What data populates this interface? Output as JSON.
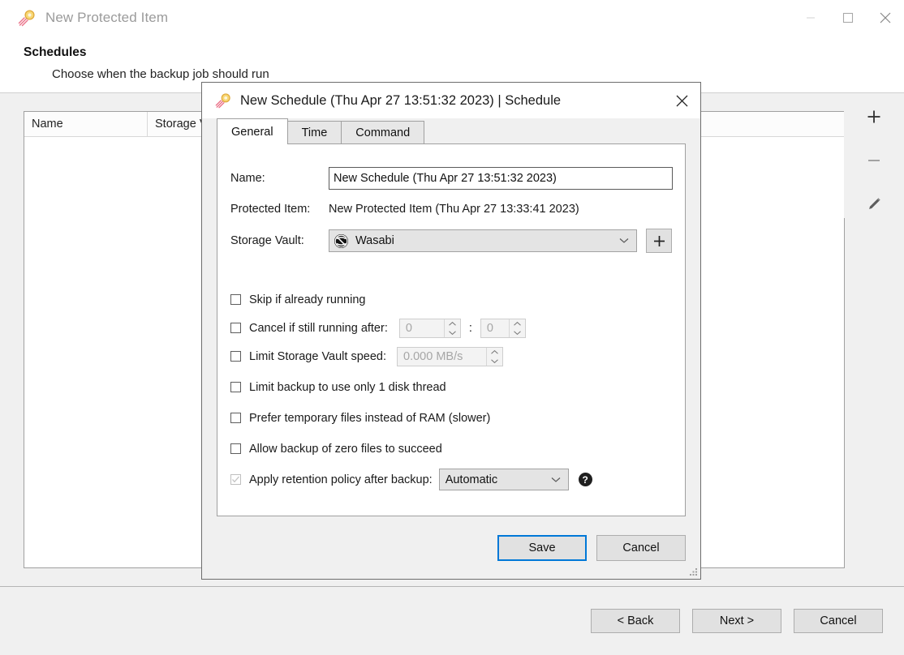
{
  "app_window": {
    "title": "New Protected Item",
    "icon": "comet-icon",
    "controls": {
      "minimize": "minimize-icon",
      "maximize": "maximize-icon",
      "close": "close-icon"
    },
    "header": {
      "title": "Schedules",
      "subtitle": "Choose when the backup job should run"
    },
    "table": {
      "columns": [
        "Name",
        "Storage V"
      ],
      "rows": []
    },
    "side_tools": [
      {
        "name": "add-schedule-button",
        "icon": "plus-icon"
      },
      {
        "name": "remove-schedule-button",
        "icon": "minus-icon"
      },
      {
        "name": "edit-schedule-button",
        "icon": "pencil-icon"
      }
    ],
    "footer_buttons": [
      {
        "name": "back-button",
        "label": "< Back"
      },
      {
        "name": "next-button",
        "label": "Next >"
      },
      {
        "name": "cancel-button",
        "label": "Cancel"
      }
    ]
  },
  "dialog": {
    "title": "New Schedule (Thu Apr 27 13:51:32 2023) | Schedule",
    "icon": "comet-icon",
    "close_label": "close-icon",
    "tabs": [
      {
        "label": "General",
        "active": true
      },
      {
        "label": "Time",
        "active": false
      },
      {
        "label": "Command",
        "active": false
      }
    ],
    "general": {
      "name_label": "Name:",
      "name_value": "New Schedule (Thu Apr 27 13:51:32 2023)",
      "protected_item_label": "Protected Item:",
      "protected_item_value": "New Protected Item (Thu Apr 27 13:33:41 2023)",
      "storage_vault_label": "Storage Vault:",
      "storage_vault_value": "Wasabi",
      "add_vault_label": "+",
      "options": [
        {
          "id": "skip-if-already-running",
          "label": "Skip if already running",
          "checked": false,
          "enabled": true
        },
        {
          "id": "cancel-if-still-running-after",
          "label": "Cancel if still running after:",
          "checked": false,
          "enabled": true,
          "hours_value": "0",
          "minutes_value": "0",
          "separator": ":"
        },
        {
          "id": "limit-storage-vault-speed",
          "label": "Limit Storage Vault speed:",
          "checked": false,
          "enabled": true,
          "speed_value": "0.000 MB/s"
        },
        {
          "id": "limit-backup-single-disk-thread",
          "label": "Limit backup to use only 1 disk thread",
          "checked": false,
          "enabled": true
        },
        {
          "id": "prefer-temporary-files",
          "label": "Prefer temporary files instead of RAM (slower)",
          "checked": false,
          "enabled": true
        },
        {
          "id": "allow-zero-files",
          "label": "Allow backup of zero files to succeed",
          "checked": false,
          "enabled": true
        },
        {
          "id": "apply-retention-policy",
          "label": "Apply retention policy after backup:",
          "checked": true,
          "enabled": false,
          "retention_value": "Automatic",
          "help_label": "?"
        }
      ]
    },
    "buttons": [
      {
        "name": "save-button",
        "label": "Save",
        "default": true
      },
      {
        "name": "cancel-button",
        "label": "Cancel",
        "default": false
      }
    ]
  },
  "colors": {
    "accent": "#0078d7",
    "window_bg": "#f0f0f0",
    "panel_bg": "#ffffff",
    "title_gray": "#9b9b9b",
    "wasabi_dark": "#1c1c1c",
    "comet_yellow": "#f5c33b",
    "comet_trail": "#e8607a"
  }
}
